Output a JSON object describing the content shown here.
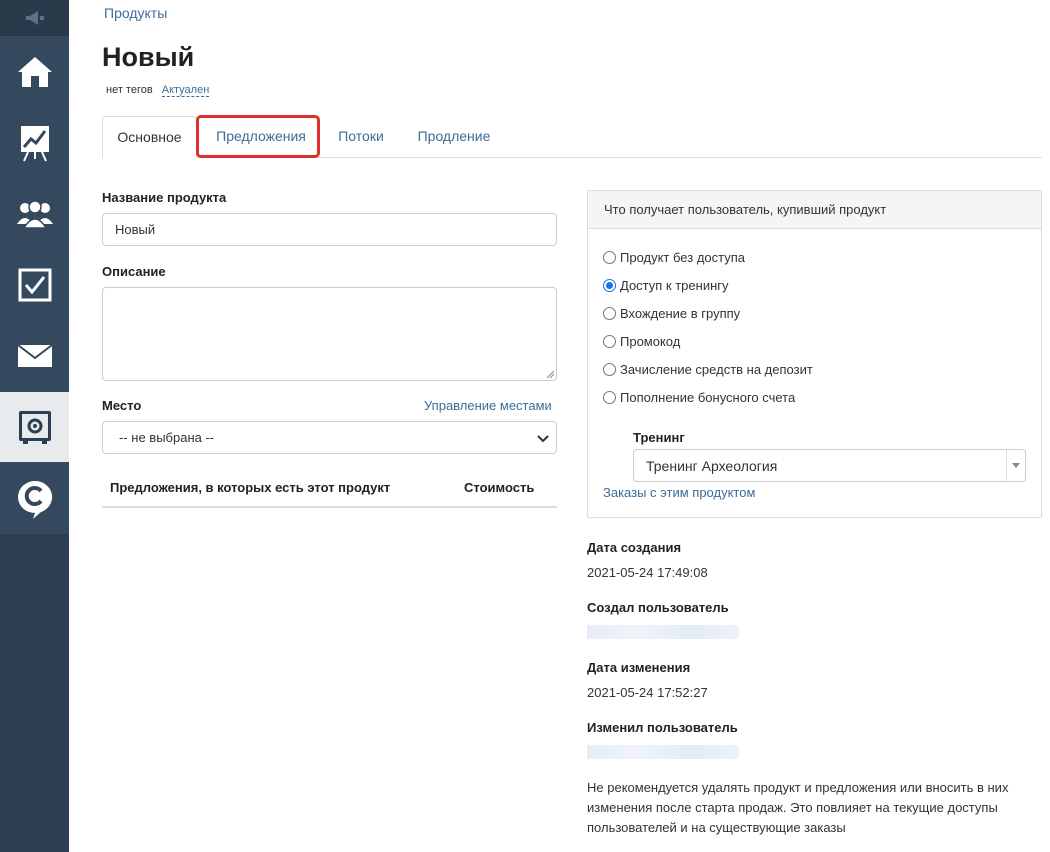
{
  "breadcrumb": "Продукты",
  "title": "Новый",
  "tags": {
    "no_tags": "нет тегов",
    "status": "Актуален"
  },
  "tabs": [
    {
      "label": "Основное"
    },
    {
      "label": "Предложения"
    },
    {
      "label": "Потоки"
    },
    {
      "label": "Продление"
    }
  ],
  "form": {
    "name_label": "Название продукта",
    "name_value": "Новый",
    "description_label": "Описание",
    "description_value": "",
    "place_label": "Место",
    "manage_places_link": "Управление местами",
    "place_selected": "-- не выбрана --",
    "offers_table": {
      "col_offers": "Предложения, в которых есть этот продукт",
      "col_price": "Стоимость"
    }
  },
  "panel": {
    "header": "Что получает пользователь, купивший продукт",
    "options": [
      {
        "label": "Продукт без доступа",
        "checked": false
      },
      {
        "label": "Доступ к тренингу",
        "checked": true
      },
      {
        "label": "Вхождение в группу",
        "checked": false
      },
      {
        "label": "Промокод",
        "checked": false
      },
      {
        "label": "Зачисление средств на депозит",
        "checked": false
      },
      {
        "label": "Пополнение бонусного счета",
        "checked": false
      }
    ],
    "training_label": "Тренинг",
    "training_selected": "Тренинг Археология",
    "orders_link": "Заказы с этим продуктом"
  },
  "meta": {
    "created_label": "Дата создания",
    "created_value": "2021-05-24 17:49:08",
    "created_by_label": "Создал пользователь",
    "modified_label": "Дата изменения",
    "modified_value": "2021-05-24 17:52:27",
    "modified_by_label": "Изменил пользователь"
  },
  "note": "Не рекомендуется удалять продукт и предложения или вносить в них изменения после старта продаж. Это повлияет на текущие доступы пользователей и на существующие заказы",
  "colors": {
    "sidebar": "#2d3e50",
    "link": "#3d6c99",
    "highlight": "#e0302b",
    "radio_accent": "#1a73e8"
  },
  "icons": [
    "megaphone-icon",
    "home-icon",
    "chart-board-icon",
    "users-icon",
    "checkbox-icon",
    "mail-icon",
    "safe-icon",
    "chat-logo-icon"
  ]
}
